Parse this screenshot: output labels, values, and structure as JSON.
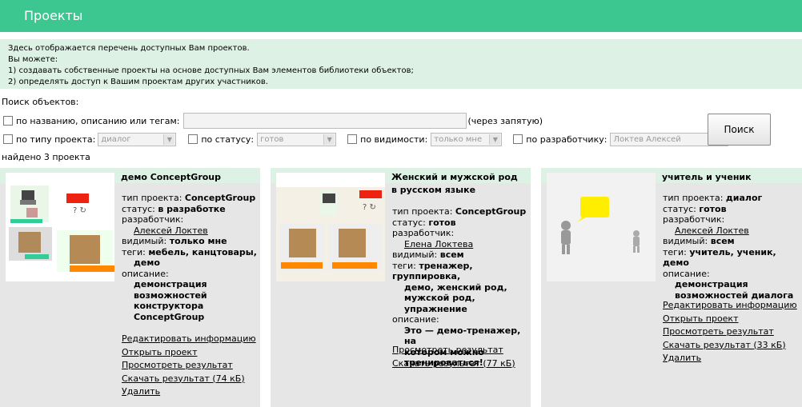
{
  "header": {
    "title": "Проекты"
  },
  "info": {
    "lines": [
      "Здесь отображается перечень доступных Вам проектов.",
      "Вы можете:",
      "1) создавать собственные проекты на основе доступных Вам элементов библиотеки объектов;",
      "2) определять доступ к Вашим проектам других участников."
    ]
  },
  "search": {
    "title": "Поиск объектов:",
    "by_name_label": "по названию, описанию или тегам:",
    "by_name_hint": "(через запятую)",
    "type_label": "по типу проекта:",
    "type_value": "диалог",
    "status_label": "по статусу:",
    "status_value": "готов",
    "visibility_label": "по видимости:",
    "visibility_value": "только мне",
    "developer_label": "по разработчику:",
    "developer_value": "Локтев Алексей",
    "button": "Поиск"
  },
  "found": "найдено 3 проекта",
  "labels": {
    "type": "тип проекта:",
    "status": "статус:",
    "developer": "разработчик:",
    "visible": "видимый:",
    "tags": "теги:",
    "description": "описание:"
  },
  "projects": [
    {
      "title": "демо ConceptGroup",
      "type": "ConceptGroup",
      "status": "в разработке",
      "developer": "Алексей Локтев",
      "visible": "только мне",
      "tags": "мебель, канцтовары,",
      "tags2": "демо",
      "description": [
        "демонстрация",
        "возможностей",
        "конструктора",
        "ConceptGroup"
      ],
      "links": [
        "Редактировать информацию",
        "Открыть проект",
        "Просмотреть результат",
        "Скачать результат (74 кБ)",
        "Удалить"
      ]
    },
    {
      "title": "Женский и мужской род в русском языке",
      "type": "ConceptGroup",
      "status": "готов",
      "developer": "Елена Локтева",
      "visible": "всем",
      "tags": "тренажер, группировка,",
      "tags2": [
        "демо, женский род,",
        "мужской род, упражнение"
      ],
      "description": [
        "Это — демо-тренажер, на",
        "котором можно",
        "тренироваться!"
      ],
      "links": [
        "Просмотреть результат",
        "Скачать результат (77 кБ)"
      ]
    },
    {
      "title": "учитель и ученик",
      "type": "диалог",
      "status": "готов",
      "developer": "Алексей Локтев",
      "visible": "всем",
      "tags": "учитель, ученик, демо",
      "description": [
        "демонстрация",
        "возможностей диалога"
      ],
      "links": [
        "Редактировать информацию",
        "Открыть проект",
        "Просмотреть результат",
        "Скачать результат (33 кБ)",
        "Удалить"
      ]
    }
  ]
}
